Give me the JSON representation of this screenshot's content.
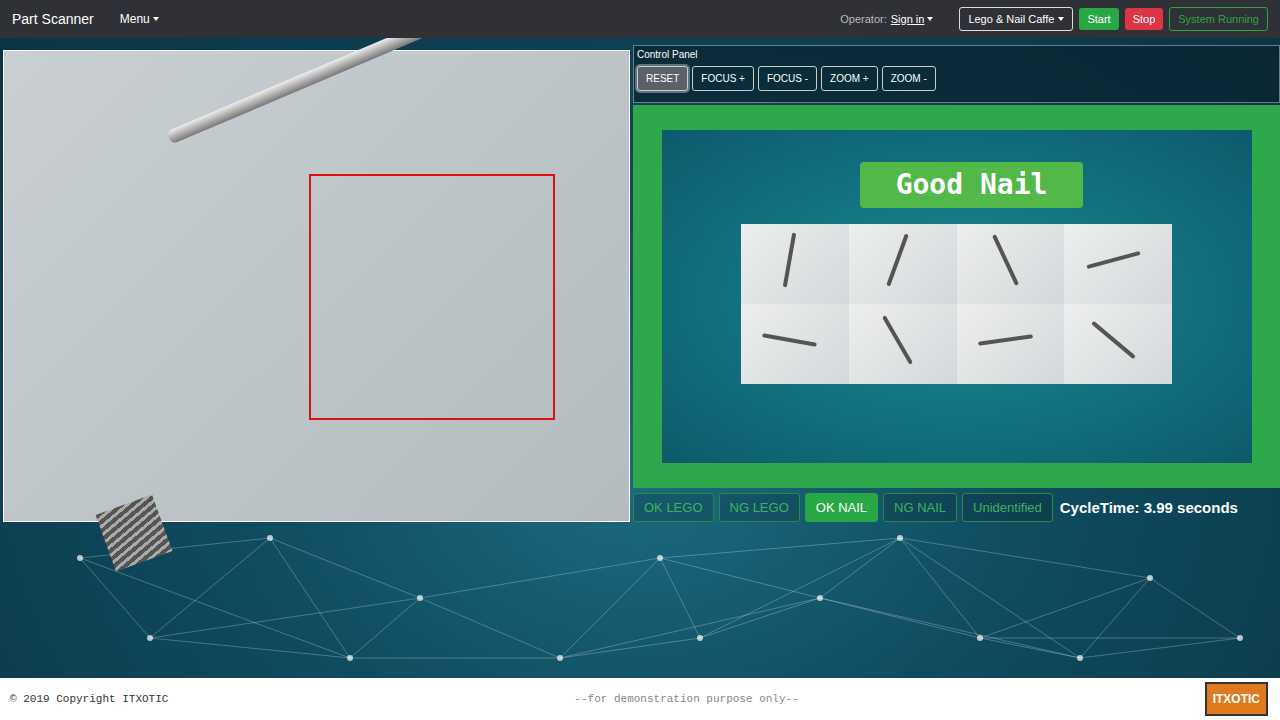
{
  "navbar": {
    "brand": "Part Scanner",
    "menu": "Menu",
    "operator_label": "Operator:",
    "operator_link": "Sign in",
    "model": "Lego & Nail Caffe",
    "start": "Start",
    "stop": "Stop",
    "status": "System Running"
  },
  "control_panel": {
    "title": "Control Panel",
    "buttons": [
      {
        "label": "RESET",
        "selected": true
      },
      {
        "label": "FOCUS +",
        "selected": false
      },
      {
        "label": "FOCUS -",
        "selected": false
      },
      {
        "label": "ZOOM +",
        "selected": false
      },
      {
        "label": "ZOOM -",
        "selected": false
      }
    ]
  },
  "result": {
    "title": "Good Nail"
  },
  "classes": [
    {
      "label": "OK LEGO",
      "selected": false
    },
    {
      "label": "NG LEGO",
      "selected": false
    },
    {
      "label": "OK NAIL",
      "selected": true
    },
    {
      "label": "NG NAIL",
      "selected": false
    },
    {
      "label": "Unidentified",
      "selected": false
    }
  ],
  "cycle_time": "CycleTime: 3.99 seconds",
  "footer": {
    "copyright": "© 2019 Copyright ITXOTIC",
    "note": "--for demonstration purpose only--",
    "logo": "ITXOTIC"
  }
}
